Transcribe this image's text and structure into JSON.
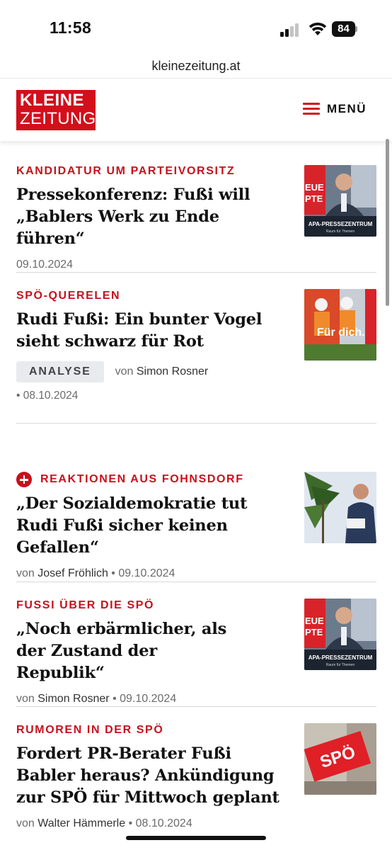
{
  "status_bar": {
    "time": "11:58",
    "battery": "84"
  },
  "browser": {
    "url": "kleinezeitung.at"
  },
  "site": {
    "logo_top": "KLEINE",
    "logo_bottom": "ZEITUNG",
    "menu_label": "MENÜ",
    "brand_color": "#d30f1a"
  },
  "articles": [
    {
      "kicker": "KANDIDATUR UM PARTEIVORSITZ",
      "headline": "Pressekonferenz: Fußi will „Bablers Werk zu Ende führen“",
      "date": "09.10.2024",
      "thumb_caption": "APA-PRESSEZENTRUM",
      "thumb_subcaption": "Raum für Themen"
    },
    {
      "kicker": "SPÖ-QUERELEN",
      "headline": "Rudi Fußi: Ein bunter Vogel sieht schwarz für Rot",
      "badge": "ANALYSE",
      "by": "von",
      "author": "Simon Rosner",
      "date": "08.10.2024",
      "thumb_text": "Für dich."
    },
    {
      "kicker": "REAKTIONEN AUS FOHNSDORF",
      "headline": "„Der Sozialdemokratie tut Rudi Fußi sicher keinen Gefallen“",
      "by": "von",
      "author": "Josef Fröhlich",
      "date": "09.10.2024"
    },
    {
      "kicker": "FUSSI ÜBER DIE SPÖ",
      "headline": "„Noch erbärmlicher, als der Zustand der Republik“",
      "by": "von",
      "author": "Simon Rosner",
      "date": "09.10.2024",
      "thumb_caption": "APA-PRESSEZENTRUM",
      "thumb_subcaption": "Raum für Themen"
    },
    {
      "kicker": "RUMOREN IN DER SPÖ",
      "headline": "Fordert PR-Berater Fußi Babler heraus? Ankündigung zur SPÖ für Mittwoch geplant",
      "by": "von",
      "author": "Walter Hämmerle",
      "date": "08.10.2024",
      "thumb_text": "SPÖ"
    }
  ]
}
